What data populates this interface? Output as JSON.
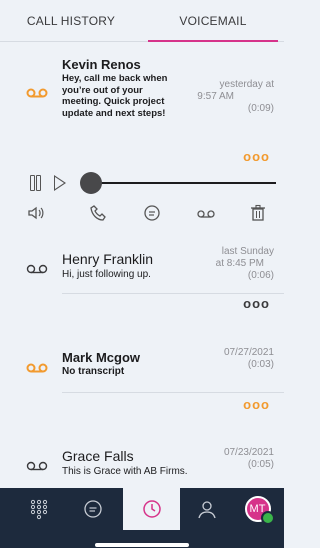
{
  "tabs": [
    {
      "label": "CALL HISTORY",
      "active": false
    },
    {
      "label": "VOICEMAIL",
      "active": true
    }
  ],
  "voicemails": [
    {
      "name": "Kevin Renos",
      "text": "Hey, call me back when you’re out of your meeting. Quick project update and next steps!",
      "when_line1": "yesterday at",
      "when_line2": "9:57 AM",
      "duration": "(0:09)",
      "unread": true,
      "more": "ooo"
    },
    {
      "name": "Henry Franklin",
      "text": "Hi, just following up.",
      "when_line1": "last Sunday",
      "when_line2": "at 8:45 PM",
      "duration": "(0:06)",
      "unread": false,
      "more": "ooo"
    },
    {
      "name": "Mark Mcgow",
      "text": "No transcript",
      "when_line1": "07/27/2021",
      "when_line2": "",
      "duration": "(0:03)",
      "unread": true,
      "more": "ooo"
    },
    {
      "name": "Grace Falls",
      "text": "This is Grace with AB Firms.",
      "when_line1": "07/23/2021",
      "when_line2": "",
      "duration": "(0:05)",
      "unread": false,
      "more": "ooo"
    }
  ],
  "player": {
    "progress": 0,
    "actions": [
      "speaker-icon",
      "phone-icon",
      "chat-icon",
      "voicemail-icon",
      "trash-icon"
    ]
  },
  "bottom_nav": {
    "items": [
      "dialpad-icon",
      "chat-icon",
      "history-icon",
      "contacts-icon",
      "avatar"
    ],
    "active": "history-icon",
    "avatar_initials": "MT"
  },
  "colors": {
    "accent": "#d6338a",
    "unread": "#f29a2e",
    "nav_bg": "#1d2a3d",
    "status_online": "#3bb54a"
  }
}
